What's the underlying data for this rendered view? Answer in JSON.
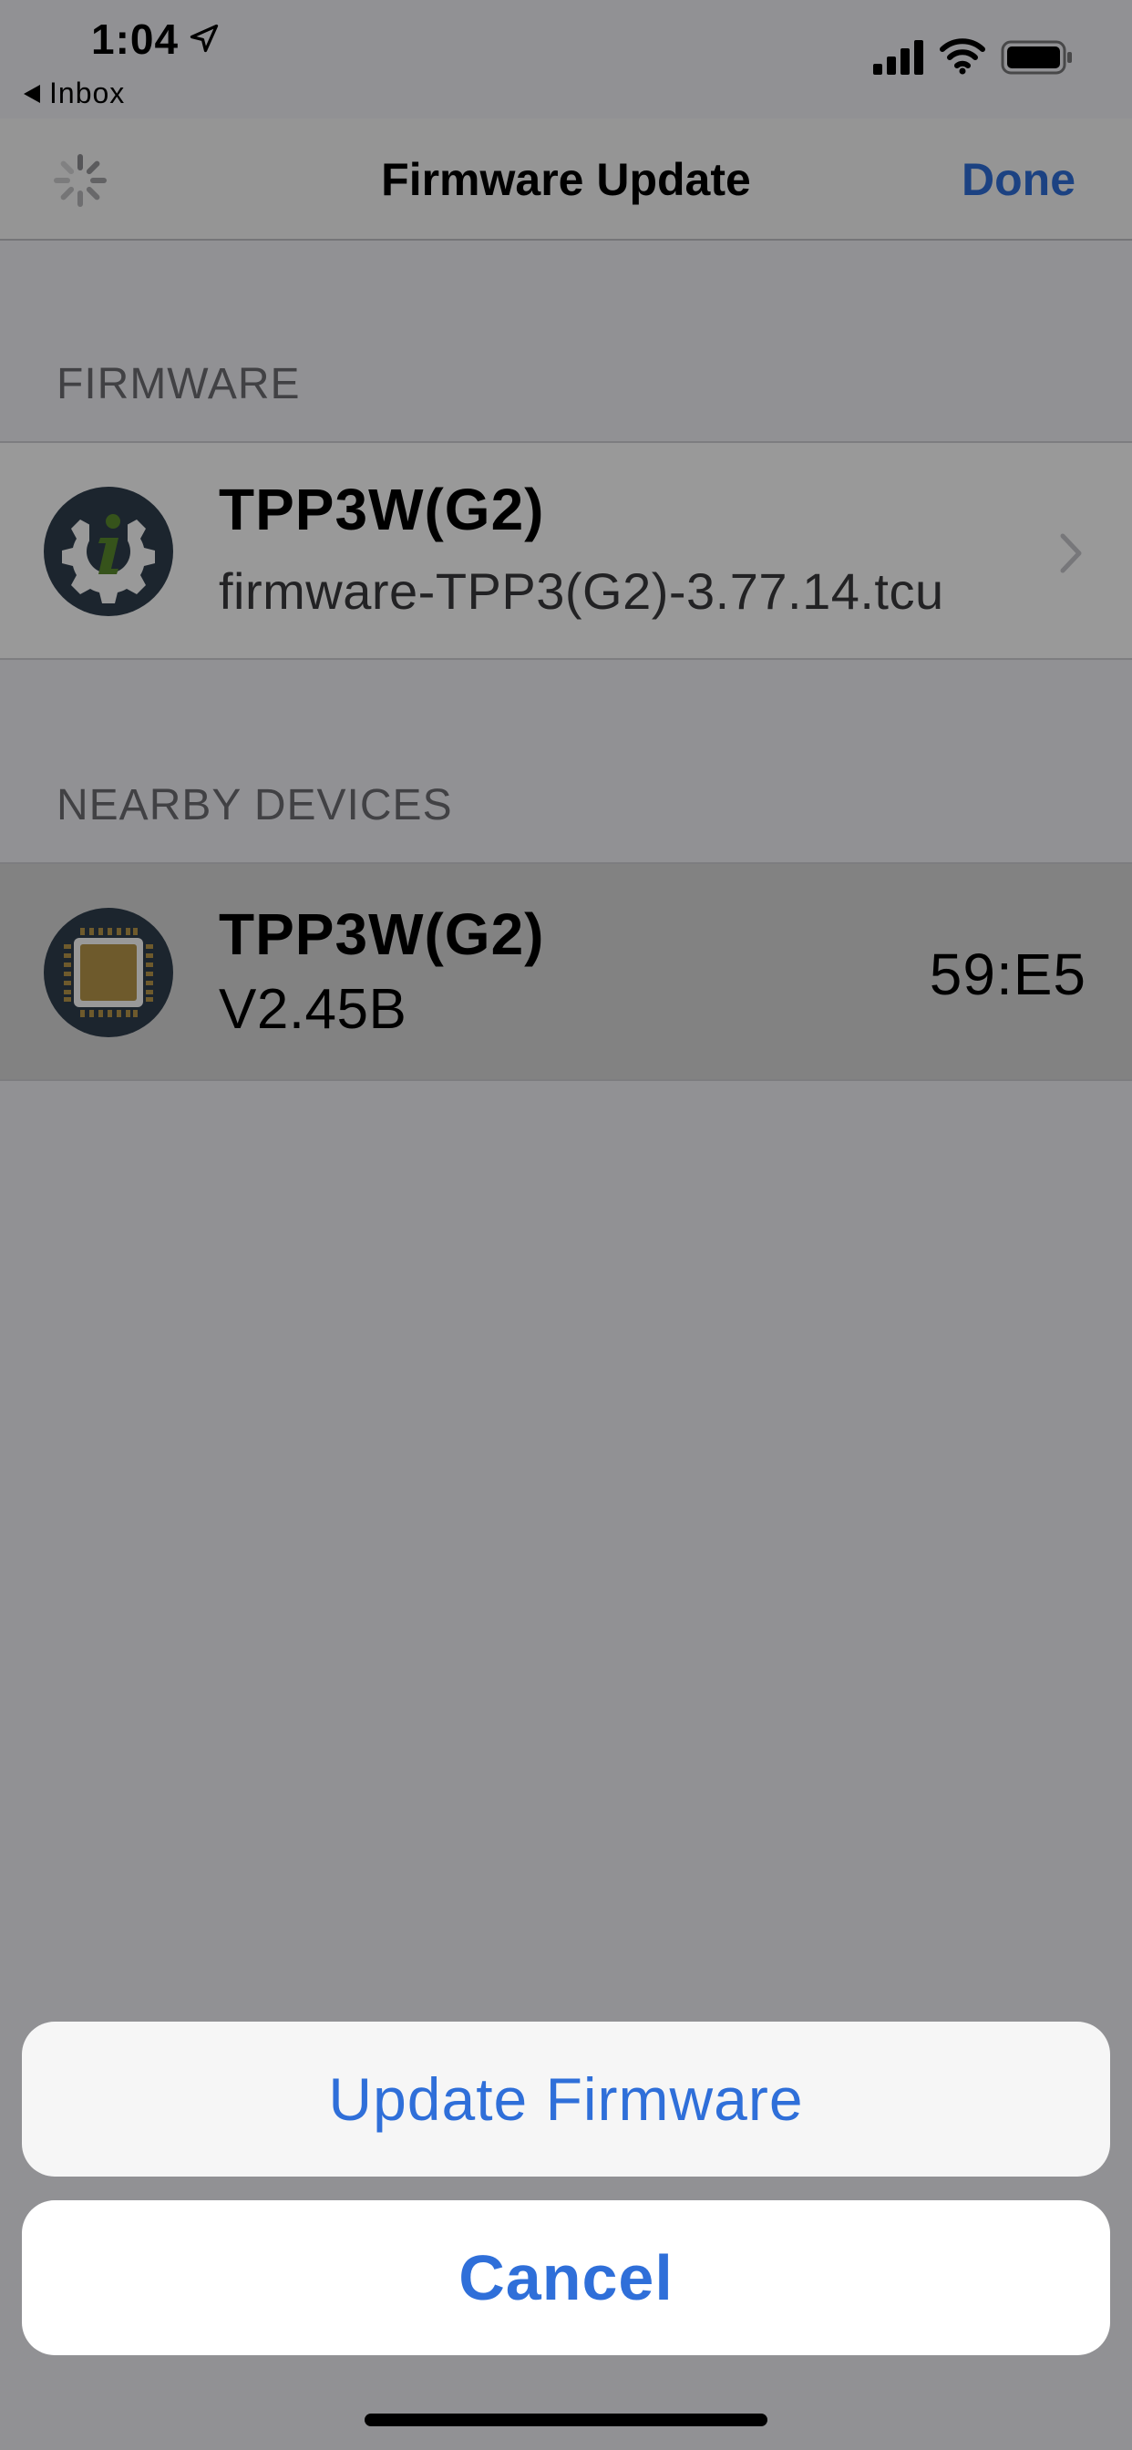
{
  "status_bar": {
    "time": "1:04",
    "back_label": "Inbox"
  },
  "nav": {
    "title": "Firmware Update",
    "done_label": "Done"
  },
  "sections": {
    "firmware": {
      "header": "FIRMWARE",
      "item": {
        "title": "TPP3W(G2)",
        "subtitle": "firmware-TPP3(G2)-3.77.14.tcu"
      }
    },
    "nearby": {
      "header": "NEARBY DEVICES",
      "item": {
        "title": "TPP3W(G2)",
        "subtitle": "V2.45B",
        "detail": "59:E5"
      }
    }
  },
  "action_sheet": {
    "primary_label": "Update Firmware",
    "cancel_label": "Cancel"
  },
  "colors": {
    "accent": "#2f6fd9",
    "icon_dark": "#2f3e4e",
    "icon_green": "#5a8a2e",
    "chip_gold": "#b8964a"
  }
}
